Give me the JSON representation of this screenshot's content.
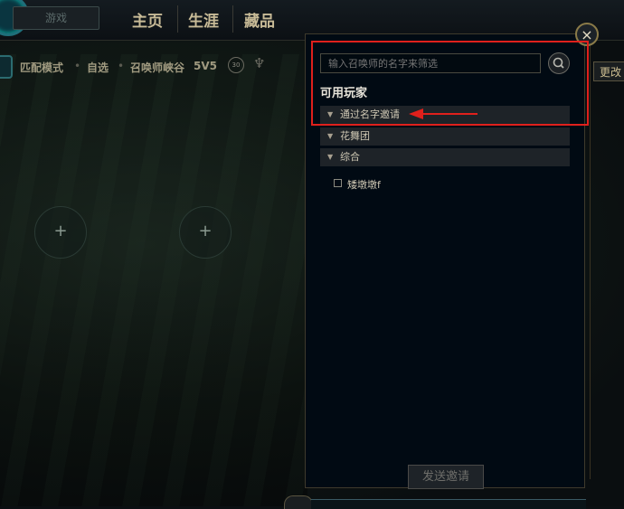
{
  "nav": {
    "play_button_label": "游戏",
    "items": [
      {
        "label": "主页"
      },
      {
        "label": "生涯"
      },
      {
        "label": "藏品"
      }
    ]
  },
  "lobby": {
    "mode": "匹配模式",
    "pick": "自选",
    "map": "召唤师峡谷",
    "size": "5V5",
    "badge": "30",
    "slot_symbol": "+",
    "change_button": "更改"
  },
  "invite_panel": {
    "search_placeholder": "输入召唤师的名字来筛选",
    "section_title": "可用玩家",
    "groups": [
      {
        "label": "通过名字邀请"
      },
      {
        "label": "花舞团"
      },
      {
        "label": "综合"
      }
    ],
    "friends": [
      {
        "name": "矮墩墩f"
      }
    ],
    "send_button": "发送邀请",
    "close_symbol": "×"
  },
  "annotation": {
    "highlight_color": "#e0201c"
  }
}
